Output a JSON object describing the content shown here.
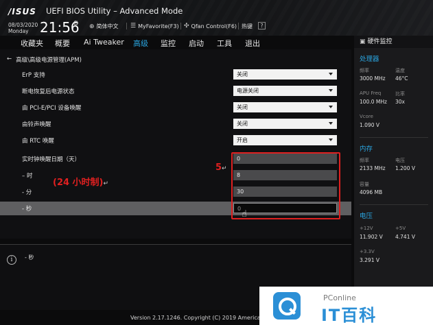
{
  "header": {
    "logo": "/ISUS",
    "title": "UEFI BIOS Utility – Advanced Mode",
    "date": "08/03/2020",
    "weekday": "Monday",
    "time": "21:56",
    "buttons": [
      {
        "icon": "globe-icon",
        "label": "简体中文"
      },
      {
        "icon": "star-list-icon",
        "label": "MyFavorite(F3)"
      },
      {
        "icon": "fan-icon",
        "label": "Qfan Control(F6)"
      },
      {
        "icon": "hotkeys-icon",
        "label": "热键"
      }
    ],
    "close": "?"
  },
  "nav": {
    "tabs": [
      "收藏夹",
      "概要",
      "Ai Tweaker",
      "高级",
      "监控",
      "启动",
      "工具",
      "退出"
    ],
    "active": "高级"
  },
  "main": {
    "breadcrumb": "高级\\高级电源管理(APM)",
    "rows": [
      {
        "label": "ErP 支持",
        "value": "关闭",
        "type": "dropdown"
      },
      {
        "label": "断电恢复后电源状态",
        "value": "电源关闭",
        "type": "dropdown"
      },
      {
        "label": "由 PCI-E/PCI 设备唤醒",
        "value": "关闭",
        "type": "dropdown"
      },
      {
        "label": "由铃声唤醒",
        "value": "关闭",
        "type": "dropdown"
      },
      {
        "label": "由 RTC 唤醒",
        "value": "开启",
        "type": "dropdown"
      },
      {
        "label": "实时钟唤醒日期（天）",
        "value": "0",
        "type": "number"
      },
      {
        "label": "– 时",
        "value": "8",
        "type": "number"
      },
      {
        "label": "- 分",
        "value": "30",
        "type": "number"
      },
      {
        "label": "- 秒",
        "value": "0",
        "type": "number"
      }
    ],
    "annotation_5": "5",
    "annotation_24": "(24 小时制)",
    "return_mark": "↵"
  },
  "info": {
    "text": "- 秒"
  },
  "footer": {
    "version": "Version 2.17.1246. Copyright (C) 2019 American"
  },
  "sidebar": {
    "title": "硬件监控",
    "cpu": {
      "heading": "处理器",
      "freq_label": "频率",
      "freq": "3000 MHz",
      "temp_label": "温度",
      "temp": "46°C",
      "apu_label": "APU Freq",
      "apu": "100.0 MHz",
      "ratio_label": "比率",
      "ratio": "30x",
      "vcore_label": "Vcore",
      "vcore": "1.090 V"
    },
    "memory": {
      "heading": "内存",
      "freq_label": "频率",
      "freq": "2133 MHz",
      "volt_label": "电压",
      "volt": "1.200 V",
      "cap_label": "容量",
      "cap": "4096 MB"
    },
    "voltage": {
      "heading": "电压",
      "v12_label": "+12V",
      "v12": "11.902 V",
      "v5_label": "+5V",
      "v5": "4.741 V",
      "v33_label": "+3.3V",
      "v33": "3.291 V"
    }
  },
  "watermark": {
    "pc": "PConline",
    "big": "IT百科"
  }
}
